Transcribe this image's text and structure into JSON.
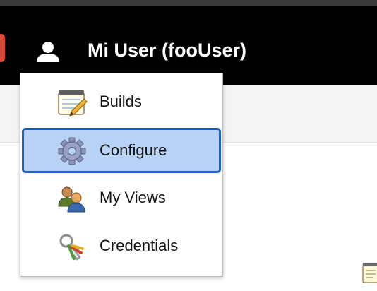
{
  "header": {
    "user_display": "Mi User (fooUser)",
    "icons": {
      "user": "user-icon",
      "logo": "logo-icon"
    },
    "colors": {
      "background": "#000000",
      "text": "#ffffff",
      "logo_accent": "#d24939"
    }
  },
  "user_menu": {
    "items": [
      {
        "label": "Builds",
        "icon": "notepad-icon",
        "selected": false
      },
      {
        "label": "Configure",
        "icon": "gear-icon",
        "selected": true
      },
      {
        "label": "My Views",
        "icon": "users-icon",
        "selected": false
      },
      {
        "label": "Credentials",
        "icon": "keys-icon",
        "selected": false
      }
    ],
    "colors": {
      "selected_background": "#b8d3f5",
      "selected_border": "#1f5fbf"
    }
  },
  "page": {
    "corner_icon": "notepad-icon"
  }
}
